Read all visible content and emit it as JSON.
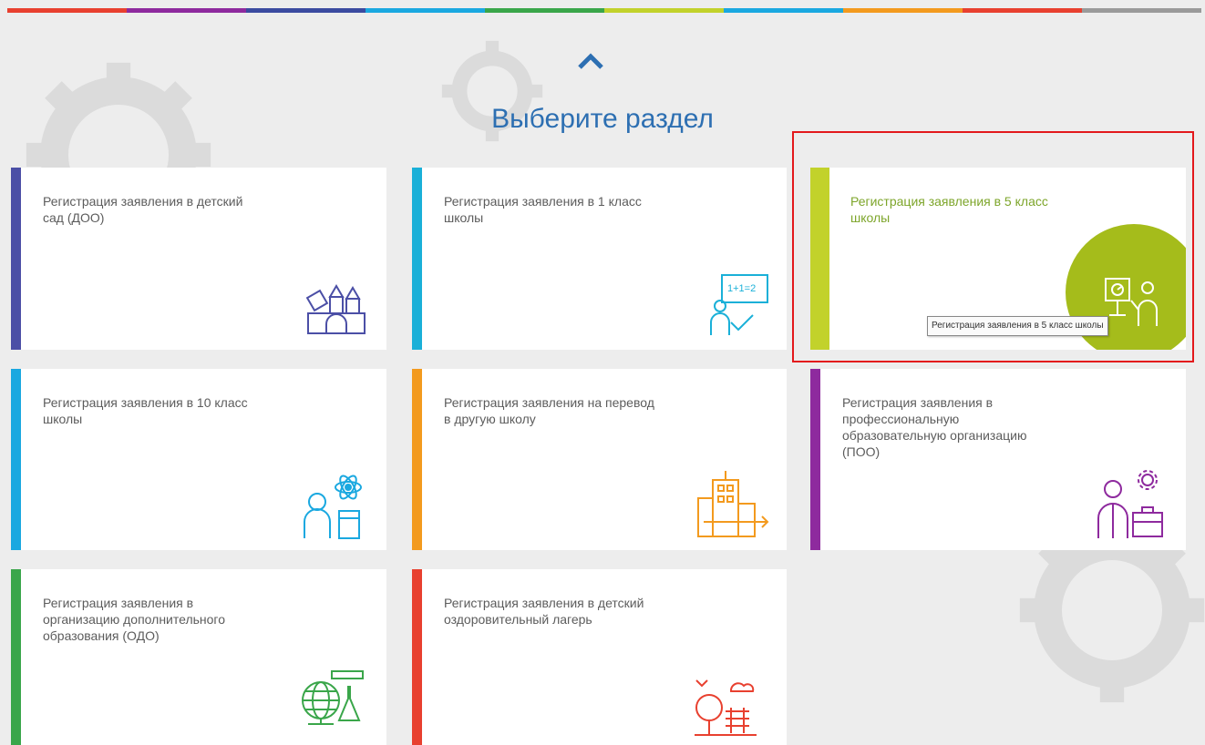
{
  "topbar": {
    "colors": [
      "#e8402f",
      "#8e2a9e",
      "#3b4ba0",
      "#1aa8e0",
      "#3aa64a",
      "#c2d22b",
      "#1aa8e0",
      "#f39a1e",
      "#e8402f",
      "#9a9a9a"
    ]
  },
  "header": {
    "title": "Выберите раздел",
    "scroll_up_icon": "chevron-up-icon"
  },
  "cards": [
    {
      "label": "Регистрация заявления в детский сад (ДОО)",
      "accent": "#4b4fa6",
      "icon": "building-blocks-icon"
    },
    {
      "label": "Регистрация заявления в 1 класс школы",
      "accent": "#1ab0d8",
      "icon": "teacher-board-icon"
    },
    {
      "label": "Регистрация заявления в 5 класс школы",
      "accent": "#c2d22b",
      "icon": "teacher-presentation-icon",
      "active": true
    },
    {
      "label": "Регистрация заявления в 10 класс школы",
      "accent": "#1aa8e0",
      "icon": "student-atom-icon"
    },
    {
      "label": "Регистрация заявления на перевод в другую школу",
      "accent": "#f39a1e",
      "icon": "school-transfer-icon"
    },
    {
      "label": "Регистрация заявления в профессиональную образовательную организацию (ПОО)",
      "accent": "#8e2a9e",
      "icon": "professional-worker-icon"
    },
    {
      "label": "Регистрация заявления в организацию дополнительного образования (ОДО)",
      "accent": "#3aa64a",
      "icon": "globe-lab-icon"
    },
    {
      "label": "Регистрация заявления в детский оздоровительный лагерь",
      "accent": "#e8402f",
      "icon": "camp-tree-icon"
    }
  ],
  "tooltip": {
    "text": "Регистрация заявления в 5 класс школы"
  },
  "colors": {
    "title": "#2d6fb2",
    "active_label": "#7da52a",
    "highlight": "#e3191c",
    "card_bg": "#ffffff",
    "page_bg": "#ededed"
  }
}
